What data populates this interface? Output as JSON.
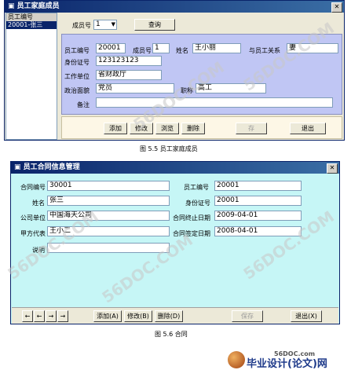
{
  "fig1": {
    "title": "员工家庭成员",
    "sidebar_header": "员工编号",
    "sidebar_item": "20001-张三",
    "member_no_label": "成员号",
    "member_no_value": "1",
    "query_button": "查询",
    "emp_no_label": "员工编号",
    "emp_no_value": "20001",
    "member_no2_label": "成员号",
    "member_no2_value": "1",
    "name_label": "姓名",
    "name_value": "王小丽",
    "relation_label": "与员工关系",
    "relation_value": "妻",
    "id_label": "身份证号",
    "id_value": "123123123",
    "work_label": "工作单位",
    "work_value": "省财政厅",
    "politics_label": "政治面貌",
    "politics_value": "党员",
    "title_label": "职称",
    "title_value": "高工",
    "remark_label": "备注",
    "remark_value": "",
    "buttons": [
      "添加",
      "修改",
      "浏览",
      "删除"
    ],
    "button_disabled": "存",
    "exit_button": "退出",
    "caption": "图 5.5  员工家庭成员"
  },
  "fig2": {
    "title": "员工合同信息管理",
    "contract_no_label": "合同编号",
    "contract_no_value": "30001",
    "emp_no_label": "员工编号",
    "emp_no_value": "20001",
    "name_label": "姓名",
    "name_value": "张三",
    "id_label": "身份证号",
    "id_value": "20001",
    "company_label": "公司单位",
    "company_value": "中国海天公司",
    "end_label": "合同终止日期",
    "end_value": "2009-04-01",
    "party_label": "甲方代表",
    "party_value": "王小二",
    "sign_label": "合同签定日期",
    "sign_value": "2008-04-01",
    "note_label": "说明",
    "note_value": "",
    "nav": [
      "←",
      "←",
      "→",
      "→"
    ],
    "add_button": "添加(A)",
    "edit_button": "修改(B)",
    "delete_button": "删除(D)",
    "save_button": "保存",
    "exit_button": "退出(X)",
    "caption": "图 5.6  合同"
  },
  "watermark": "56DOC.COM",
  "footer": {
    "site": "56DOC.com",
    "brand": "毕业设计(论文)网"
  },
  "colors": {
    "title_bar": "#0a246a",
    "panel_blue": "#c0c6f4",
    "panel_cyan": "#c6f6f6",
    "window_gray": "#ece9d8"
  }
}
